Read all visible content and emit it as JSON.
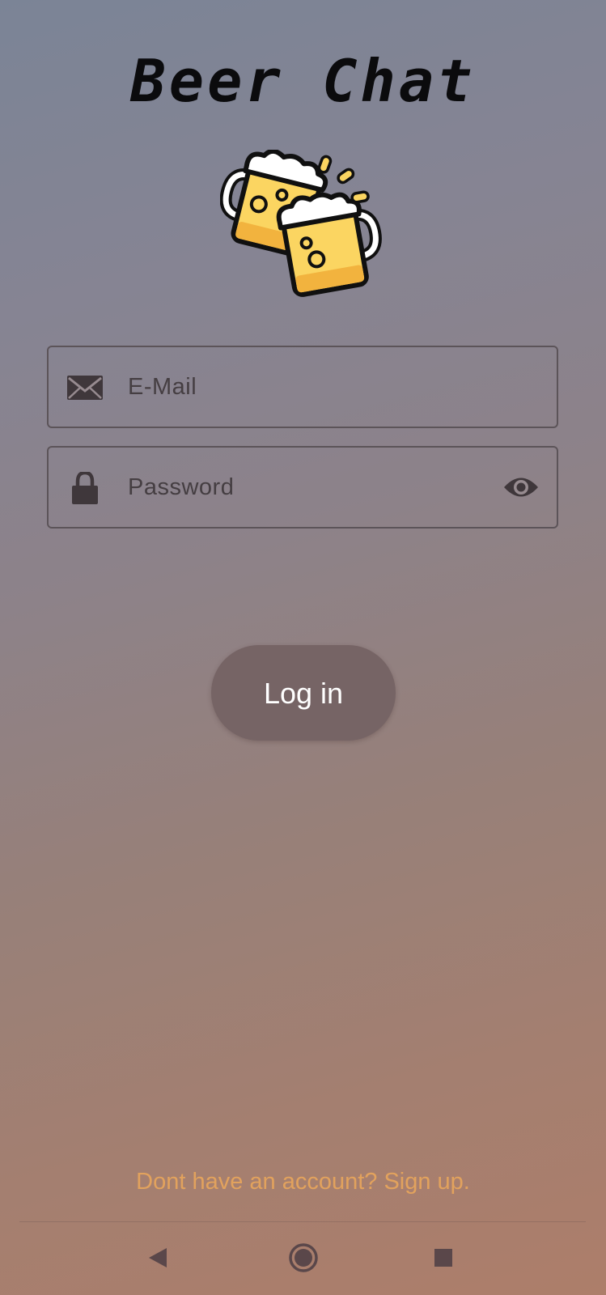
{
  "app": {
    "title": "Beer Chat"
  },
  "logo": {
    "icon": "clinking-beer-mugs-icon"
  },
  "login_form": {
    "email": {
      "placeholder": "E-Mail",
      "icon": "mail-icon"
    },
    "password": {
      "placeholder": "Password",
      "icon": "lock-icon",
      "toggle_icon": "eye-icon"
    },
    "submit_label": "Log in"
  },
  "footer": {
    "signup_text": "Dont have an account? Sign up."
  },
  "system_nav": {
    "back_icon": "back-triangle-icon",
    "home_icon": "home-circle-icon",
    "recents_icon": "recents-square-icon"
  },
  "colors": {
    "button_bg": "#766465",
    "link": "#e2a25d",
    "title": "#0b0b0d"
  }
}
